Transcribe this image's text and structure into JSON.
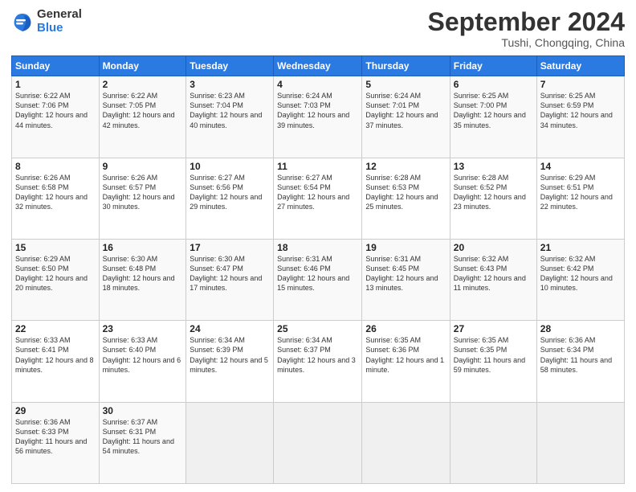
{
  "logo": {
    "general": "General",
    "blue": "Blue"
  },
  "header": {
    "month": "September 2024",
    "location": "Tushi, Chongqing, China"
  },
  "weekdays": [
    "Sunday",
    "Monday",
    "Tuesday",
    "Wednesday",
    "Thursday",
    "Friday",
    "Saturday"
  ],
  "weeks": [
    [
      {
        "day": "1",
        "sunrise": "6:22 AM",
        "sunset": "7:06 PM",
        "daylight": "12 hours and 44 minutes."
      },
      {
        "day": "2",
        "sunrise": "6:22 AM",
        "sunset": "7:05 PM",
        "daylight": "12 hours and 42 minutes."
      },
      {
        "day": "3",
        "sunrise": "6:23 AM",
        "sunset": "7:04 PM",
        "daylight": "12 hours and 40 minutes."
      },
      {
        "day": "4",
        "sunrise": "6:24 AM",
        "sunset": "7:03 PM",
        "daylight": "12 hours and 39 minutes."
      },
      {
        "day": "5",
        "sunrise": "6:24 AM",
        "sunset": "7:01 PM",
        "daylight": "12 hours and 37 minutes."
      },
      {
        "day": "6",
        "sunrise": "6:25 AM",
        "sunset": "7:00 PM",
        "daylight": "12 hours and 35 minutes."
      },
      {
        "day": "7",
        "sunrise": "6:25 AM",
        "sunset": "6:59 PM",
        "daylight": "12 hours and 34 minutes."
      }
    ],
    [
      {
        "day": "8",
        "sunrise": "6:26 AM",
        "sunset": "6:58 PM",
        "daylight": "12 hours and 32 minutes."
      },
      {
        "day": "9",
        "sunrise": "6:26 AM",
        "sunset": "6:57 PM",
        "daylight": "12 hours and 30 minutes."
      },
      {
        "day": "10",
        "sunrise": "6:27 AM",
        "sunset": "6:56 PM",
        "daylight": "12 hours and 29 minutes."
      },
      {
        "day": "11",
        "sunrise": "6:27 AM",
        "sunset": "6:54 PM",
        "daylight": "12 hours and 27 minutes."
      },
      {
        "day": "12",
        "sunrise": "6:28 AM",
        "sunset": "6:53 PM",
        "daylight": "12 hours and 25 minutes."
      },
      {
        "day": "13",
        "sunrise": "6:28 AM",
        "sunset": "6:52 PM",
        "daylight": "12 hours and 23 minutes."
      },
      {
        "day": "14",
        "sunrise": "6:29 AM",
        "sunset": "6:51 PM",
        "daylight": "12 hours and 22 minutes."
      }
    ],
    [
      {
        "day": "15",
        "sunrise": "6:29 AM",
        "sunset": "6:50 PM",
        "daylight": "12 hours and 20 minutes."
      },
      {
        "day": "16",
        "sunrise": "6:30 AM",
        "sunset": "6:48 PM",
        "daylight": "12 hours and 18 minutes."
      },
      {
        "day": "17",
        "sunrise": "6:30 AM",
        "sunset": "6:47 PM",
        "daylight": "12 hours and 17 minutes."
      },
      {
        "day": "18",
        "sunrise": "6:31 AM",
        "sunset": "6:46 PM",
        "daylight": "12 hours and 15 minutes."
      },
      {
        "day": "19",
        "sunrise": "6:31 AM",
        "sunset": "6:45 PM",
        "daylight": "12 hours and 13 minutes."
      },
      {
        "day": "20",
        "sunrise": "6:32 AM",
        "sunset": "6:43 PM",
        "daylight": "12 hours and 11 minutes."
      },
      {
        "day": "21",
        "sunrise": "6:32 AM",
        "sunset": "6:42 PM",
        "daylight": "12 hours and 10 minutes."
      }
    ],
    [
      {
        "day": "22",
        "sunrise": "6:33 AM",
        "sunset": "6:41 PM",
        "daylight": "12 hours and 8 minutes."
      },
      {
        "day": "23",
        "sunrise": "6:33 AM",
        "sunset": "6:40 PM",
        "daylight": "12 hours and 6 minutes."
      },
      {
        "day": "24",
        "sunrise": "6:34 AM",
        "sunset": "6:39 PM",
        "daylight": "12 hours and 5 minutes."
      },
      {
        "day": "25",
        "sunrise": "6:34 AM",
        "sunset": "6:37 PM",
        "daylight": "12 hours and 3 minutes."
      },
      {
        "day": "26",
        "sunrise": "6:35 AM",
        "sunset": "6:36 PM",
        "daylight": "12 hours and 1 minute."
      },
      {
        "day": "27",
        "sunrise": "6:35 AM",
        "sunset": "6:35 PM",
        "daylight": "11 hours and 59 minutes."
      },
      {
        "day": "28",
        "sunrise": "6:36 AM",
        "sunset": "6:34 PM",
        "daylight": "11 hours and 58 minutes."
      }
    ],
    [
      {
        "day": "29",
        "sunrise": "6:36 AM",
        "sunset": "6:33 PM",
        "daylight": "11 hours and 56 minutes."
      },
      {
        "day": "30",
        "sunrise": "6:37 AM",
        "sunset": "6:31 PM",
        "daylight": "11 hours and 54 minutes."
      },
      null,
      null,
      null,
      null,
      null
    ]
  ]
}
